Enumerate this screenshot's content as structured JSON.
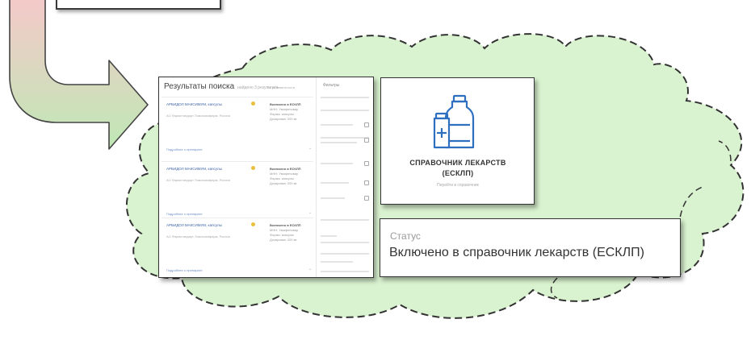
{
  "search_results": {
    "title": "Результаты поиска",
    "subtitle": "найдено 3 результата",
    "sort_label": "По релевантности",
    "filters_title": "Фильтры",
    "results": [
      {
        "name": "АРБИДОЛ МАКСИМУМ, капсулы",
        "meta": "АО Фармстандарт-Томскхимфарм, Россия",
        "status": "Включено в ЕСКЛП",
        "details": [
          "МНН: Умифеновир",
          "Форма: капсулы",
          "Дозировка: 200 мг"
        ],
        "link": "Подробнее о препарате"
      },
      {
        "name": "АРБИДОЛ МАКСИМУМ, капсулы",
        "meta": "АО Фармстандарт-Томскхимфарм, Россия",
        "status": "Включено в ЕСКЛП",
        "details": [
          "МНН: Умифеновир",
          "Форма: капсулы",
          "Дозировка: 200 мг"
        ],
        "link": "Подробнее о препарате"
      },
      {
        "name": "АРБИДОЛ МАКСИМУМ, капсулы",
        "meta": "АО Фармстандарт-Томскхимфарм, Россия",
        "status": "Включено в ЕСКЛП",
        "details": [
          "МНН: Умифеновир",
          "Форма: капсулы",
          "Дозировка: 200 мг"
        ],
        "link": "Подробнее о препарате"
      }
    ]
  },
  "drug_directory": {
    "icon": "medicine-bottles-icon",
    "title_line1": "СПРАВОЧНИК ЛЕКАРСТВ",
    "title_line2": "(ЕСКЛП)",
    "subtitle": "Перейти в справочник"
  },
  "status_panel": {
    "label": "Статус",
    "value": "Включено в справочник лекарств (ЕСКЛП)"
  },
  "colors": {
    "cloud_fill": "#d9f2cf",
    "cloud_stroke": "#333333",
    "arrow_gradient_top": "#f4c9c9",
    "arrow_gradient_bottom": "#bfe8b5",
    "link_blue": "#3c63a8",
    "icon_blue": "#2e6fc0"
  }
}
